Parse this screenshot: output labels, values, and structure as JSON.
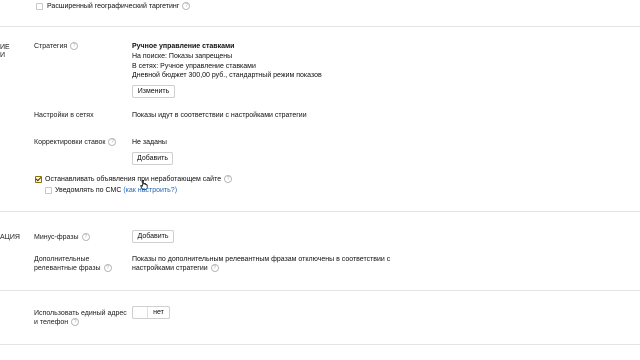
{
  "geo": {
    "label": "Расширенный географический таргетинг",
    "checked": false
  },
  "strategy_section": {
    "title_fragment_1": "ИЕ",
    "title_fragment_2": "И"
  },
  "strategy": {
    "label": "Стратегия",
    "name": "Ручное управление ставками",
    "search": "На поиске: Показы запрещены",
    "networks": "В сетях: Ручное управление ставками",
    "budget": "Дневной бюджет 300,00 руб., стандартный режим показов",
    "change_button": "Изменить"
  },
  "network_settings": {
    "label": "Настройки в сетях",
    "value": "Показы идут в соответствии с настройками стратегии"
  },
  "bid_adjustments": {
    "label": "Корректировки ставок",
    "value": "Не заданы",
    "add_button": "Добавить"
  },
  "stop_ads": {
    "label": "Останавливать объявления при неработающем сайте",
    "checked": true
  },
  "sms_notify": {
    "label": "Уведомлять по СМС",
    "link": "(как настроить?)",
    "checked": false
  },
  "phrases_section": {
    "title_fragment": "АЦИЯ"
  },
  "minus_phrases": {
    "label": "Минус-фразы",
    "add_button": "Добавить"
  },
  "relevant_phrases": {
    "label_line1": "Дополнительные",
    "label_line2": "релевантные фразы",
    "value_line1": "Показы по дополнительным релевантным фразам отключены в соответствии с",
    "value_line2": "настройками стратегии"
  },
  "single_address": {
    "label_line1": "Использовать единый адрес",
    "label_line2": "и телефон",
    "toggle_value": "нет"
  }
}
